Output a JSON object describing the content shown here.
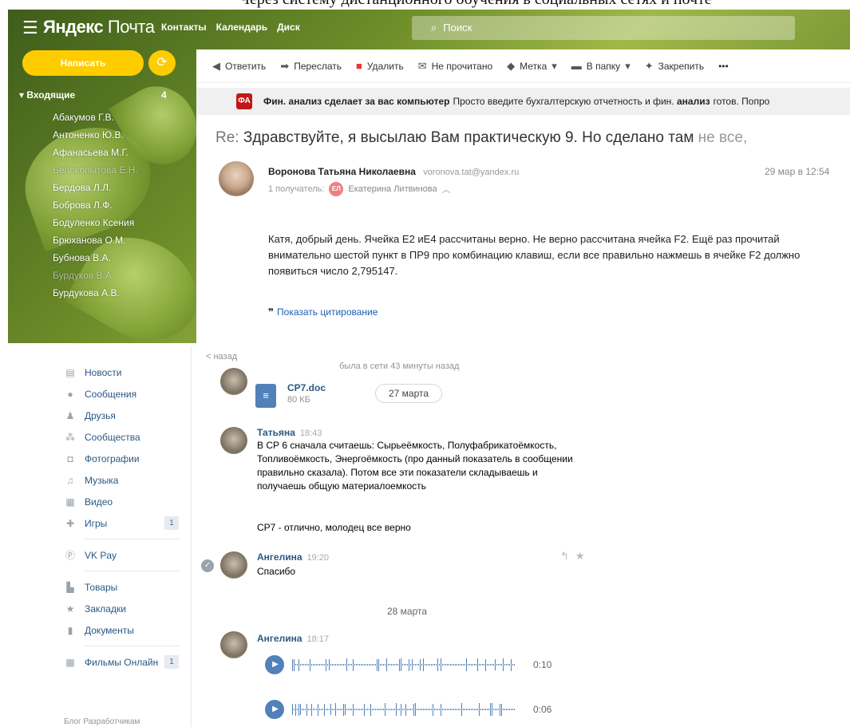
{
  "doc_text": "Через систему дистанционного обучения в социальных сетях и почте",
  "yandex": {
    "logo_main": "Яндекс",
    "logo_sub": "Почта",
    "nav": [
      "Контакты",
      "Календарь",
      "Диск"
    ],
    "search_placeholder": "Поиск",
    "compose_label": "Написать",
    "inbox_label": "Входящие",
    "inbox_count": "4",
    "contacts": [
      "Абакумов Г.В.",
      "Антоненко Ю.В.",
      "Афанасьева М.Г.",
      "Белокопытова Е.Н.",
      "Бердова Л.Л.",
      "Боброва Л.Ф.",
      "Бодуленко Ксения",
      "Брюханова О.М.",
      "Бубнова В.А.",
      "Бурдуков В.А.",
      "Бурдукова А.В."
    ],
    "toolbar": {
      "reply": "Ответить",
      "forward": "Переслать",
      "delete": "Удалить",
      "unread": "Не прочитано",
      "label": "Метка",
      "to_folder": "В папку",
      "pin": "Закрепить",
      "more": "•••"
    },
    "ad": {
      "icon_text": "ФА",
      "bold": "Фин. анализ сделает за вас компьютер",
      "text": "Просто введите бухгалтерскую отчетность и фин.",
      "bold2": "анализ",
      "text2": "готов. Попро"
    },
    "subject_prefix": "Re:",
    "subject": "Здравствуйте, я высылаю Вам практическую 9. Но сделано там",
    "subject_fade": "не все,",
    "sender_name": "Воронова Татьяна Николаевна",
    "sender_email": "voronova.tat@yandex.ru",
    "recipients_label": "1 получатель:",
    "recipient_initials": "ЕЛ",
    "recipient_name": "Екатерина Литвинова",
    "date": "29 мар в 12:54",
    "body": "Катя, добрый день. Ячейка Е2 иЕ4 рассчитаны верно. Не верно рассчитана ячейка F2. Ещё раз прочитай внимательно шестой пункт в ПР9 про комбинацию клавиш, если все правильно нажмешь в ячейке F2 должно появиться число 2,795147.",
    "show_quote": "Показать цитирование"
  },
  "vk": {
    "menu": [
      {
        "label": "Новости",
        "icon": "news-icon"
      },
      {
        "label": "Сообщения",
        "icon": "messages-icon"
      },
      {
        "label": "Друзья",
        "icon": "friends-icon"
      },
      {
        "label": "Сообщества",
        "icon": "groups-icon"
      },
      {
        "label": "Фотографии",
        "icon": "photo-icon"
      },
      {
        "label": "Музыка",
        "icon": "music-icon"
      },
      {
        "label": "Видео",
        "icon": "video-icon"
      },
      {
        "label": "Игры",
        "icon": "games-icon",
        "count": "1"
      }
    ],
    "menu2": [
      {
        "label": "VK Pay",
        "icon": "vkpay-icon"
      }
    ],
    "menu3": [
      {
        "label": "Товары",
        "icon": "goods-icon"
      },
      {
        "label": "Закладки",
        "icon": "bookmark-icon"
      },
      {
        "label": "Документы",
        "icon": "document-icon"
      }
    ],
    "menu4": [
      {
        "label": "Фильмы Онлайн",
        "icon": "films-icon",
        "count": "1"
      }
    ],
    "footer": "Блог   Разработчикам",
    "chat": {
      "back_label": "< назад",
      "status": "была в сети 43 минуты назад",
      "file_name": "СР7.doc",
      "file_size": "80 КБ",
      "date_pill": "27 марта",
      "msg1_name": "Татьяна",
      "msg1_time": "18:43",
      "msg1_text": "В СР 6 сначала считаешь: Сырьеёмкость, Полуфабрикатоёмкость, Топливоёмкость, Энергоёмкость (про данный показатель в сообщении правильно сказала). Потом все эти показатели складываешь и получаешь общую материалоемкость",
      "msg1_text2": "СР7 - отлично, молодец все верно",
      "msg2_name": "Ангелина",
      "msg2_time": "19:20",
      "msg2_text": "Спасибо",
      "day_label": "28 марта",
      "msg3_name": "Ангелина",
      "msg3_time": "18:17",
      "voice1_duration": "0:10",
      "voice2_duration": "0:06"
    }
  }
}
